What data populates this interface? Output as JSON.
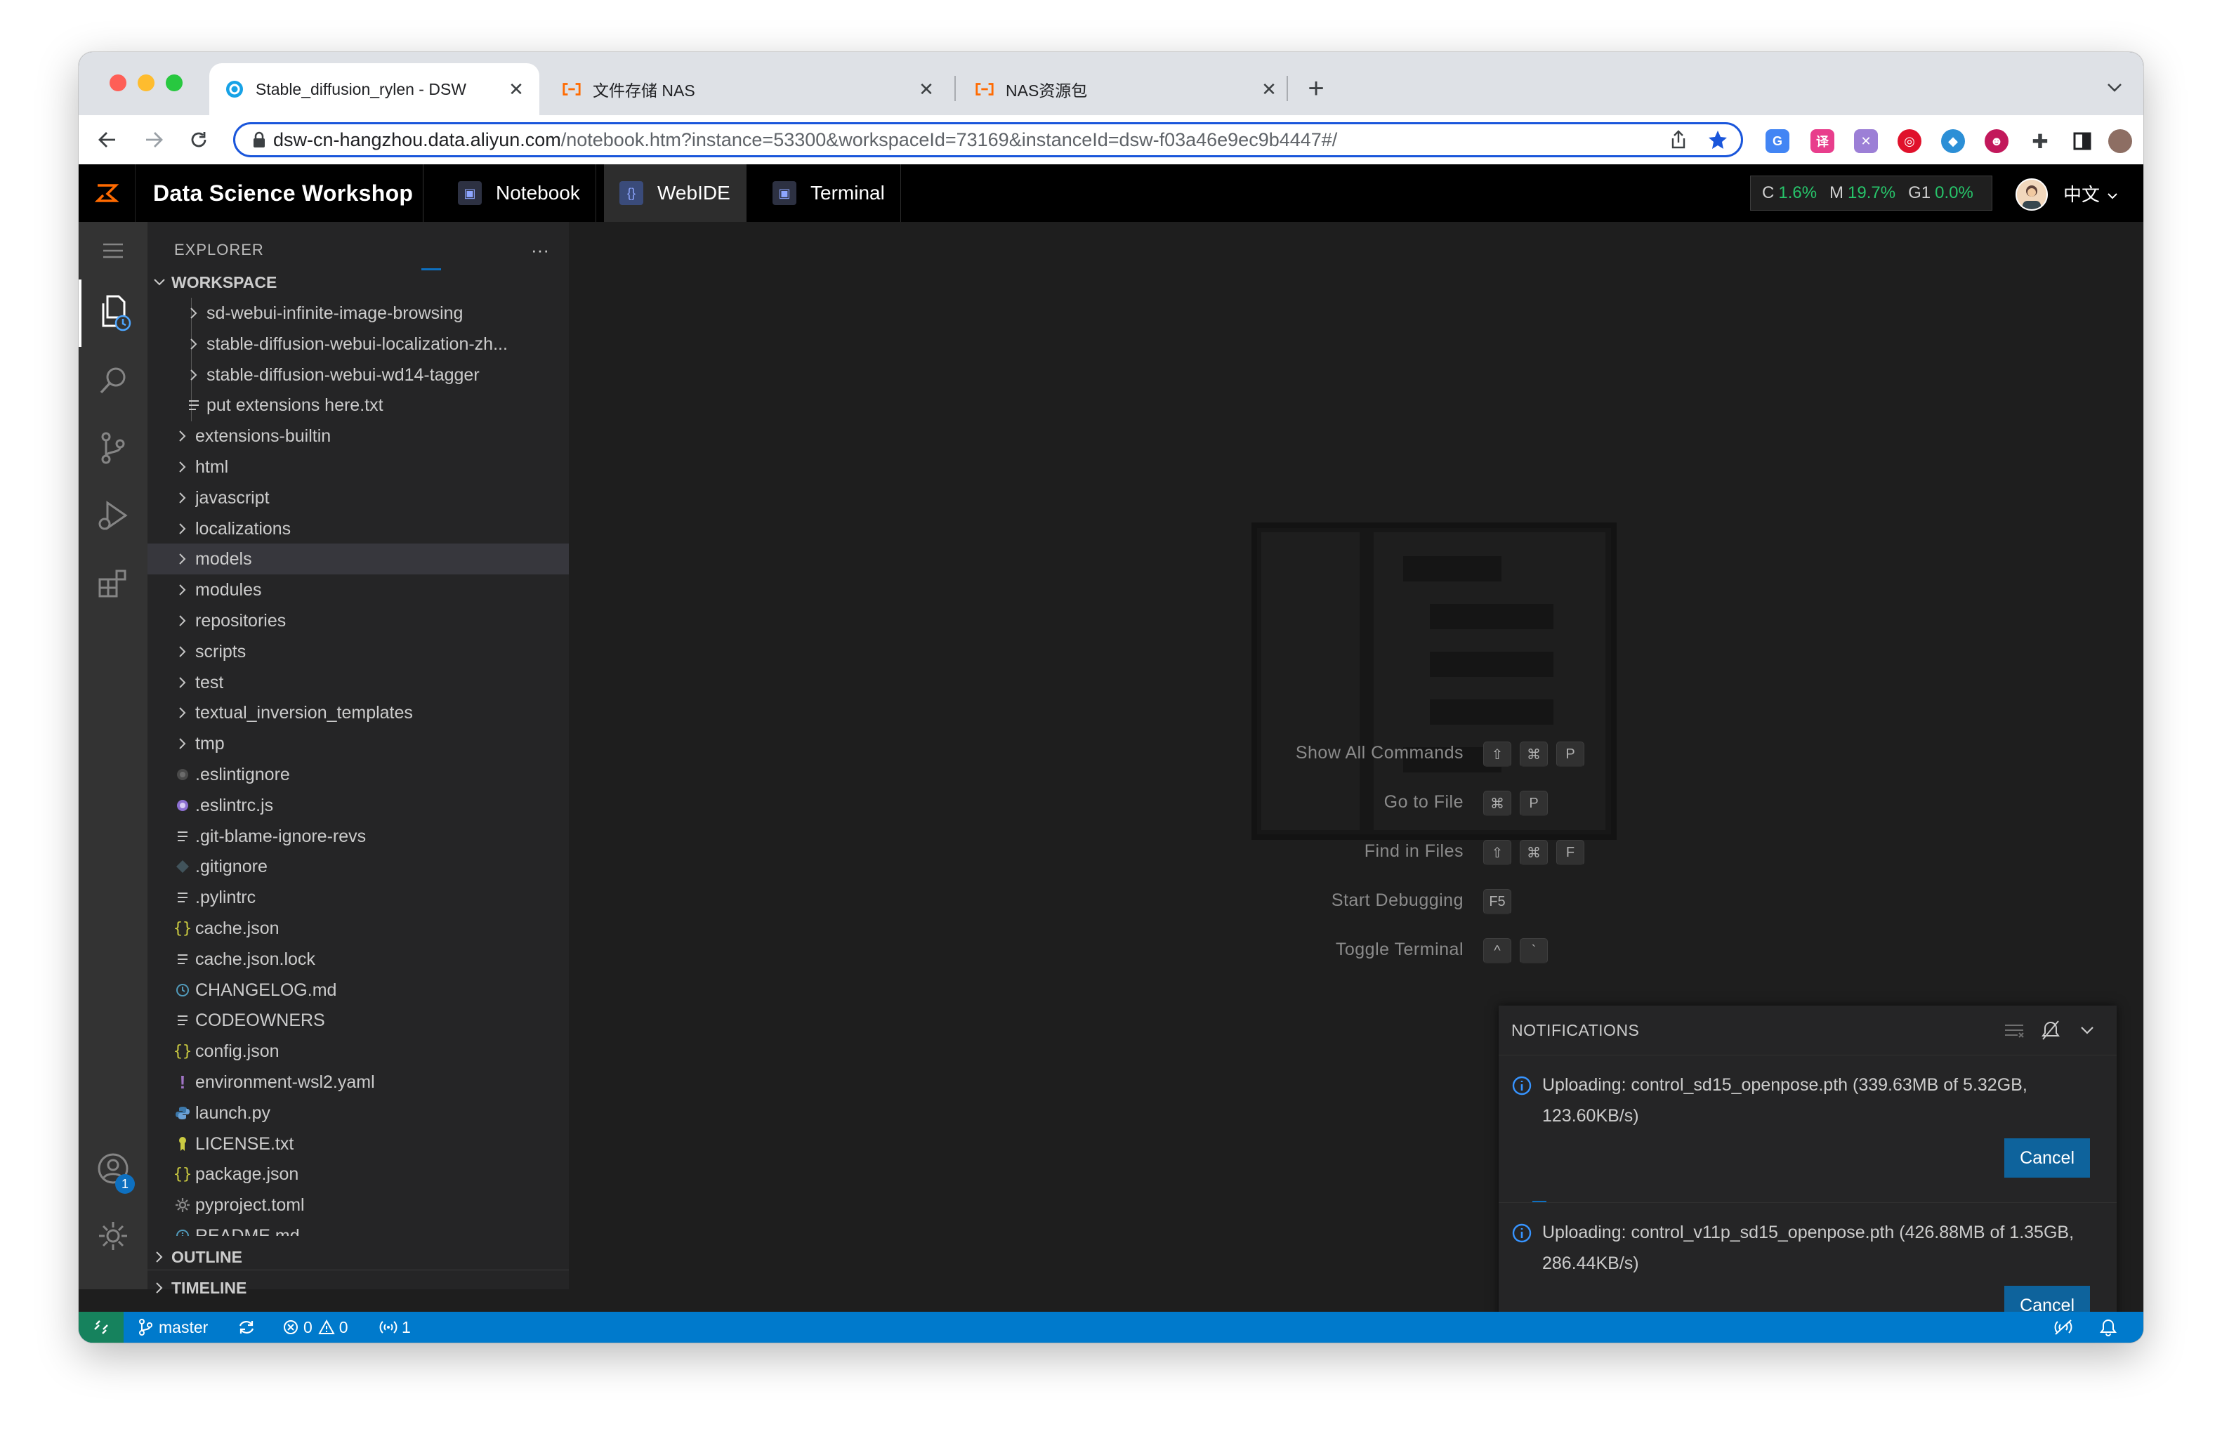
{
  "browser": {
    "tabs": [
      {
        "title": "Stable_diffusion_rylen - DSW",
        "active": true
      },
      {
        "title": "文件存储 NAS",
        "active": false
      },
      {
        "title": "NAS资源包",
        "active": false
      }
    ],
    "url_host": "dsw-cn-hangzhou.data.aliyun.com",
    "url_path": "/notebook.htm?instance=53300&workspaceId=73169&instanceId=dsw-f03a46e9ec9b4447#/"
  },
  "dsw": {
    "title": "Data Science Workshop",
    "tabs": [
      {
        "label": "Notebook"
      },
      {
        "label": "WebIDE"
      },
      {
        "label": "Terminal"
      }
    ],
    "resources": [
      {
        "label": "C",
        "value": "1.6%"
      },
      {
        "label": "M",
        "value": "19.7%"
      },
      {
        "label": "G1",
        "value": "0.0%"
      }
    ],
    "language": "中文"
  },
  "explorer": {
    "header": "EXPLORER",
    "workspace_label": "WORKSPACE",
    "outline_label": "OUTLINE",
    "timeline_label": "TIMELINE",
    "accounts_badge": "1",
    "items": [
      {
        "name": "sd-webui-infinite-image-browsing",
        "kind": "folder",
        "level": 2,
        "icon": "chevron-right"
      },
      {
        "name": "stable-diffusion-webui-localization-zh...",
        "kind": "folder",
        "level": 2,
        "icon": "chevron-right"
      },
      {
        "name": "stable-diffusion-webui-wd14-tagger",
        "kind": "folder",
        "level": 2,
        "icon": "chevron-right"
      },
      {
        "name": "put extensions here.txt",
        "kind": "file",
        "level": 2,
        "icon": "text-lines"
      },
      {
        "name": "extensions-builtin",
        "kind": "folder",
        "level": 1,
        "icon": "chevron-right"
      },
      {
        "name": "html",
        "kind": "folder",
        "level": 1,
        "icon": "chevron-right"
      },
      {
        "name": "javascript",
        "kind": "folder",
        "level": 1,
        "icon": "chevron-right"
      },
      {
        "name": "localizations",
        "kind": "folder",
        "level": 1,
        "icon": "chevron-right"
      },
      {
        "name": "models",
        "kind": "folder",
        "level": 1,
        "icon": "chevron-right",
        "selected": true
      },
      {
        "name": "modules",
        "kind": "folder",
        "level": 1,
        "icon": "chevron-right"
      },
      {
        "name": "repositories",
        "kind": "folder",
        "level": 1,
        "icon": "chevron-right"
      },
      {
        "name": "scripts",
        "kind": "folder",
        "level": 1,
        "icon": "chevron-right"
      },
      {
        "name": "test",
        "kind": "folder",
        "level": 1,
        "icon": "chevron-right"
      },
      {
        "name": "textual_inversion_templates",
        "kind": "folder",
        "level": 1,
        "icon": "chevron-right"
      },
      {
        "name": "tmp",
        "kind": "folder",
        "level": 1,
        "icon": "chevron-right"
      },
      {
        "name": ".eslintignore",
        "kind": "file",
        "level": 1,
        "icon": "eslint-gray"
      },
      {
        "name": ".eslintrc.js",
        "kind": "file",
        "level": 1,
        "icon": "eslint-purple"
      },
      {
        "name": ".git-blame-ignore-revs",
        "kind": "file",
        "level": 1,
        "icon": "text-lines"
      },
      {
        "name": ".gitignore",
        "kind": "file",
        "level": 1,
        "icon": "git-diamond"
      },
      {
        "name": ".pylintrc",
        "kind": "file",
        "level": 1,
        "icon": "text-lines"
      },
      {
        "name": "cache.json",
        "kind": "file",
        "level": 1,
        "icon": "json-braces"
      },
      {
        "name": "cache.json.lock",
        "kind": "file",
        "level": 1,
        "icon": "text-lines"
      },
      {
        "name": "CHANGELOG.md",
        "kind": "file",
        "level": 1,
        "icon": "clock-blue"
      },
      {
        "name": "CODEOWNERS",
        "kind": "file",
        "level": 1,
        "icon": "text-lines"
      },
      {
        "name": "config.json",
        "kind": "file",
        "level": 1,
        "icon": "json-braces"
      },
      {
        "name": "environment-wsl2.yaml",
        "kind": "file",
        "level": 1,
        "icon": "exclamation-purple"
      },
      {
        "name": "launch.py",
        "kind": "file",
        "level": 1,
        "icon": "python"
      },
      {
        "name": "LICENSE.txt",
        "kind": "file",
        "level": 1,
        "icon": "license-key"
      },
      {
        "name": "package.json",
        "kind": "file",
        "level": 1,
        "icon": "json-braces"
      },
      {
        "name": "pyproject.toml",
        "kind": "file",
        "level": 1,
        "icon": "gear-gray"
      },
      {
        "name": "README.md",
        "kind": "file",
        "level": 1,
        "icon": "info-blue"
      }
    ]
  },
  "welcome": {
    "hints": [
      {
        "label": "Show All Commands",
        "keys": [
          "⇧",
          "⌘",
          "P"
        ]
      },
      {
        "label": "Go to File",
        "keys": [
          "⌘",
          "P"
        ]
      },
      {
        "label": "Find in Files",
        "keys": [
          "⇧",
          "⌘",
          "F"
        ]
      },
      {
        "label": "Start Debugging",
        "keys": [
          "F5"
        ]
      },
      {
        "label": "Toggle Terminal",
        "keys": [
          "^",
          "`"
        ]
      }
    ]
  },
  "notifications": {
    "title": "NOTIFICATIONS",
    "items": [
      {
        "line1": "Uploading: control_sd15_openpose.pth (339.63MB of 5.32GB,",
        "line2": "123.60KB/s)",
        "button": "Cancel"
      },
      {
        "line1": "Uploading: control_v11p_sd15_openpose.pth (426.88MB of 1.35GB,",
        "line2": "286.44KB/s)",
        "button": "Cancel"
      }
    ]
  },
  "statusbar": {
    "branch": "master",
    "errors": "0",
    "warnings": "0",
    "ports": "1"
  },
  "colors": {
    "accent": "#007acc",
    "button": "#0e639c",
    "resource_green": "#27c46a",
    "omnibox_border": "#1a56db"
  }
}
